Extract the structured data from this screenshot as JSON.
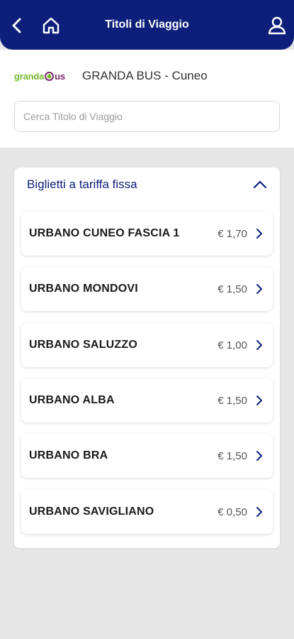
{
  "header": {
    "title": "Titoli di Viaggio",
    "back_icon": "chevron-left-icon",
    "home_icon": "home-icon",
    "user_icon": "user-icon",
    "bg_color": "#0d1f7a"
  },
  "operator": {
    "logo_text_1": "granda",
    "logo_text_2": "us",
    "name": "GRANDA BUS - Cuneo"
  },
  "search": {
    "placeholder": "Cerca Titolo di Viaggio"
  },
  "section": {
    "title": "Biglietti a tariffa fissa",
    "toggle_icon": "chevron-up-icon",
    "items": [
      {
        "name": "URBANO CUNEO FASCIA 1",
        "price": "€ 1,70"
      },
      {
        "name": "URBANO MONDOVI",
        "price": "€ 1,50"
      },
      {
        "name": "URBANO SALUZZO",
        "price": "€ 1,00"
      },
      {
        "name": "URBANO ALBA",
        "price": "€ 1,50"
      },
      {
        "name": "URBANO BRA",
        "price": "€ 1,50"
      },
      {
        "name": "URBANO SAVIGLIANO",
        "price": "€ 0,50"
      }
    ]
  }
}
